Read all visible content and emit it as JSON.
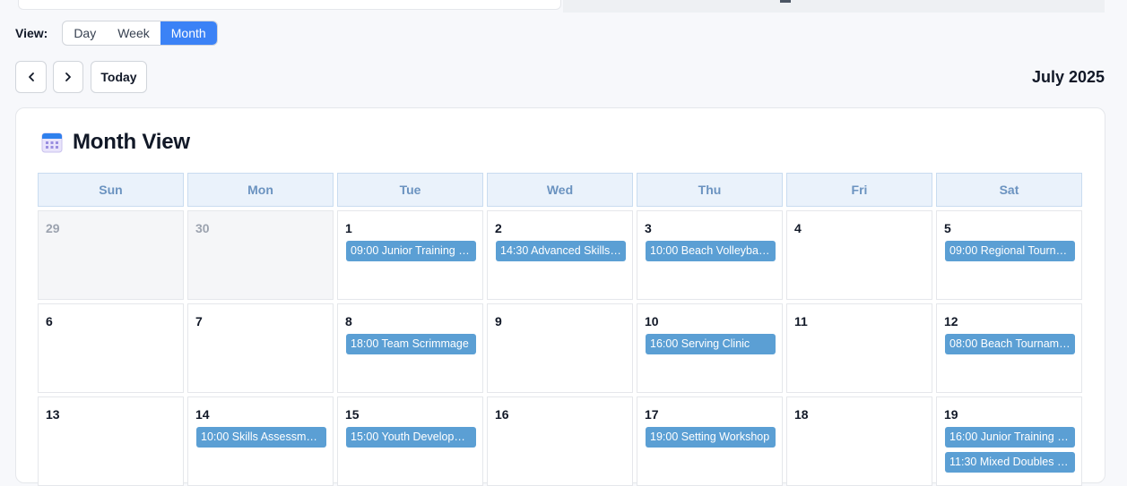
{
  "view": {
    "label": "View:",
    "options": [
      "Day",
      "Week",
      "Month"
    ],
    "active": "Month"
  },
  "nav": {
    "prev_icon": "chevron-left-icon",
    "next_icon": "chevron-right-icon",
    "today_label": "Today",
    "period_title": "July 2025"
  },
  "card": {
    "icon": "calendar-icon",
    "title": "Month View"
  },
  "colors": {
    "accent": "#3b82f6",
    "event": "#5b9fd4",
    "header_bg": "#eaf2fb",
    "header_text": "#6b93c0"
  },
  "weekdays": [
    "Sun",
    "Mon",
    "Tue",
    "Wed",
    "Thu",
    "Fri",
    "Sat"
  ],
  "weeks": [
    [
      {
        "day": "29",
        "other": true,
        "events": []
      },
      {
        "day": "30",
        "other": true,
        "events": []
      },
      {
        "day": "1",
        "events": [
          "09:00 Junior Training Se..."
        ]
      },
      {
        "day": "2",
        "events": [
          "14:30 Advanced Skills W..."
        ]
      },
      {
        "day": "3",
        "events": [
          "10:00 Beach Volleyball P..."
        ]
      },
      {
        "day": "4",
        "events": []
      },
      {
        "day": "5",
        "events": [
          "09:00 Regional Tournam..."
        ]
      }
    ],
    [
      {
        "day": "6",
        "events": []
      },
      {
        "day": "7",
        "events": []
      },
      {
        "day": "8",
        "events": [
          "18:00 Team Scrimmage"
        ]
      },
      {
        "day": "9",
        "events": []
      },
      {
        "day": "10",
        "events": [
          "16:00 Serving Clinic"
        ]
      },
      {
        "day": "11",
        "events": []
      },
      {
        "day": "12",
        "events": [
          "08:00 Beach Tournamen..."
        ]
      }
    ],
    [
      {
        "day": "13",
        "events": []
      },
      {
        "day": "14",
        "events": [
          "10:00 Skills Assessment ..."
        ]
      },
      {
        "day": "15",
        "events": [
          "15:00 Youth Development"
        ]
      },
      {
        "day": "16",
        "events": []
      },
      {
        "day": "17",
        "events": [
          "19:00 Setting Workshop"
        ]
      },
      {
        "day": "18",
        "events": []
      },
      {
        "day": "19",
        "events": [
          "16:00 Junior Training Se...",
          "11:30 Mixed Doubles Pr..."
        ]
      }
    ]
  ]
}
